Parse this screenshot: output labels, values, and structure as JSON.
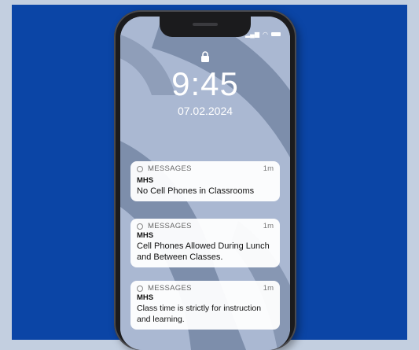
{
  "lockscreen": {
    "time": "9:45",
    "date": "07.02.2024"
  },
  "notifications": [
    {
      "app": "MESSAGES",
      "age": "1m",
      "sender": "MHS",
      "body": "No Cell Phones in Classrooms"
    },
    {
      "app": "MESSAGES",
      "age": "1m",
      "sender": "MHS",
      "body": "Cell Phones Allowed During Lunch and Between Classes."
    },
    {
      "app": "MESSAGES",
      "age": "1m",
      "sender": "MHS",
      "body": "Class time is strictly for instruction and learning."
    }
  ],
  "colors": {
    "background_panel": "#0b45a6",
    "page_background": "#c3cfe0",
    "wallpaper_light": "#aab8d2",
    "wallpaper_dark": "#7d8eab"
  },
  "icons": [
    "lock-icon",
    "signal-icon",
    "wifi-icon",
    "battery-icon",
    "message-app-icon"
  ]
}
